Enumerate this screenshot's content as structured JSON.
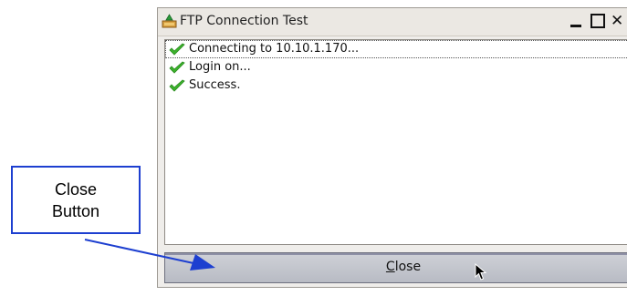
{
  "window": {
    "title": "FTP Connection Test",
    "controls": [
      "minimize-icon",
      "maximize-icon",
      "close-icon"
    ],
    "close_glyph": "✕"
  },
  "log": {
    "items": [
      {
        "text": "Connecting to 10.10.1.170...",
        "icon": "check-icon",
        "focused": true
      },
      {
        "text": "Login on...",
        "icon": "check-icon"
      },
      {
        "text": "Success.",
        "icon": "check-icon"
      }
    ],
    "icon_color": "#3cb32c"
  },
  "close_button": {
    "accel": "C",
    "rest": "lose"
  },
  "annotation": {
    "text": "Close\nButton",
    "color": "#1d3fd0"
  }
}
